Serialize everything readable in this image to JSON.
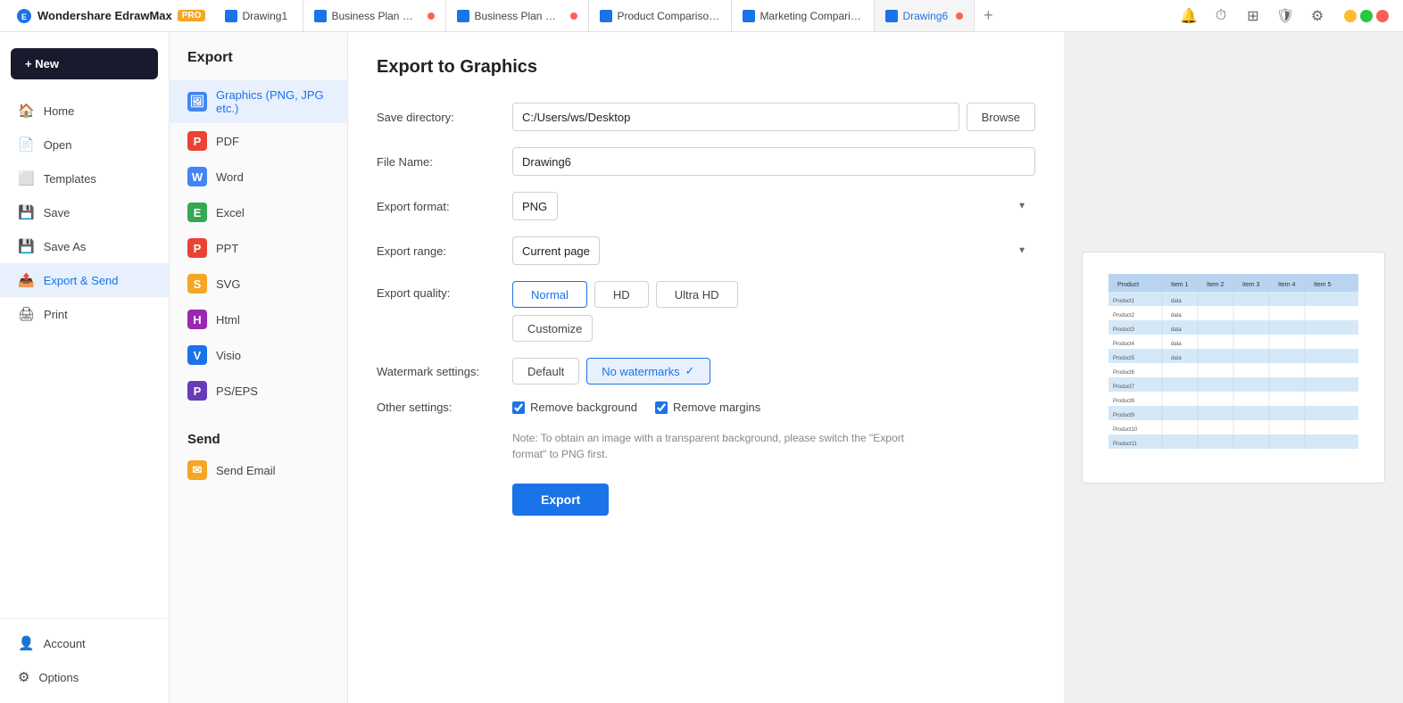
{
  "app": {
    "name": "Wondershare EdrawMax",
    "badge": "PRO"
  },
  "tabs": [
    {
      "id": "drawing1",
      "label": "Drawing1",
      "dot": "none"
    },
    {
      "id": "business1",
      "label": "Business Plan Co...",
      "dot": "red"
    },
    {
      "id": "business2",
      "label": "Business Plan Co...",
      "dot": "red"
    },
    {
      "id": "product",
      "label": "Product Comparison...",
      "dot": "none"
    },
    {
      "id": "marketing",
      "label": "Marketing Comparis...",
      "dot": "none"
    },
    {
      "id": "drawing6",
      "label": "Drawing6",
      "dot": "red",
      "active": true
    }
  ],
  "sidebar": {
    "new_label": "+ New",
    "items": [
      {
        "id": "home",
        "label": "Home",
        "icon": "🏠"
      },
      {
        "id": "open",
        "label": "Open",
        "icon": "📄"
      },
      {
        "id": "templates",
        "label": "Templates",
        "icon": "⬜"
      },
      {
        "id": "save",
        "label": "Save",
        "icon": "💾"
      },
      {
        "id": "saveas",
        "label": "Save As",
        "icon": "💾"
      },
      {
        "id": "export",
        "label": "Export & Send",
        "icon": "📤",
        "active": true
      },
      {
        "id": "print",
        "label": "Print",
        "icon": "🖨"
      }
    ],
    "footer": [
      {
        "id": "account",
        "label": "Account",
        "icon": "👤"
      },
      {
        "id": "options",
        "label": "Options",
        "icon": "⚙"
      }
    ]
  },
  "export_panel": {
    "title": "Export",
    "items": [
      {
        "id": "graphics",
        "label": "Graphics (PNG, JPG etc.)",
        "color": "graphics",
        "active": true
      },
      {
        "id": "pdf",
        "label": "PDF",
        "color": "pdf"
      },
      {
        "id": "word",
        "label": "Word",
        "color": "word"
      },
      {
        "id": "excel",
        "label": "Excel",
        "color": "excel"
      },
      {
        "id": "ppt",
        "label": "PPT",
        "color": "ppt"
      },
      {
        "id": "svg",
        "label": "SVG",
        "color": "svg"
      },
      {
        "id": "html",
        "label": "Html",
        "color": "html"
      },
      {
        "id": "visio",
        "label": "Visio",
        "color": "visio"
      },
      {
        "id": "pseps",
        "label": "PS/EPS",
        "color": "pseps"
      }
    ],
    "send_title": "Send",
    "send_items": [
      {
        "id": "email",
        "label": "Send Email",
        "color": "email"
      }
    ]
  },
  "form": {
    "title": "Export to Graphics",
    "save_directory_label": "Save directory:",
    "save_directory_value": "C:/Users/ws/Desktop",
    "browse_label": "Browse",
    "file_name_label": "File Name:",
    "file_name_value": "Drawing6",
    "export_format_label": "Export format:",
    "export_format_value": "PNG",
    "export_range_label": "Export range:",
    "export_range_value": "Current page",
    "export_quality_label": "Export quality:",
    "quality_options": [
      {
        "id": "normal",
        "label": "Normal",
        "active": true
      },
      {
        "id": "hd",
        "label": "HD",
        "active": false
      },
      {
        "id": "ultrahd",
        "label": "Ultra HD",
        "active": false
      }
    ],
    "customize_label": "Customize",
    "watermark_label": "Watermark settings:",
    "watermark_options": [
      {
        "id": "default",
        "label": "Default",
        "active": false
      },
      {
        "id": "nowatermark",
        "label": "No watermarks",
        "active": true
      }
    ],
    "other_settings_label": "Other settings:",
    "remove_background_label": "Remove background",
    "remove_background_checked": true,
    "remove_margins_label": "Remove margins",
    "remove_margins_checked": true,
    "note_text": "Note: To obtain an image with a transparent background, please switch the \"Export format\" to PNG first.",
    "export_button_label": "Export"
  }
}
